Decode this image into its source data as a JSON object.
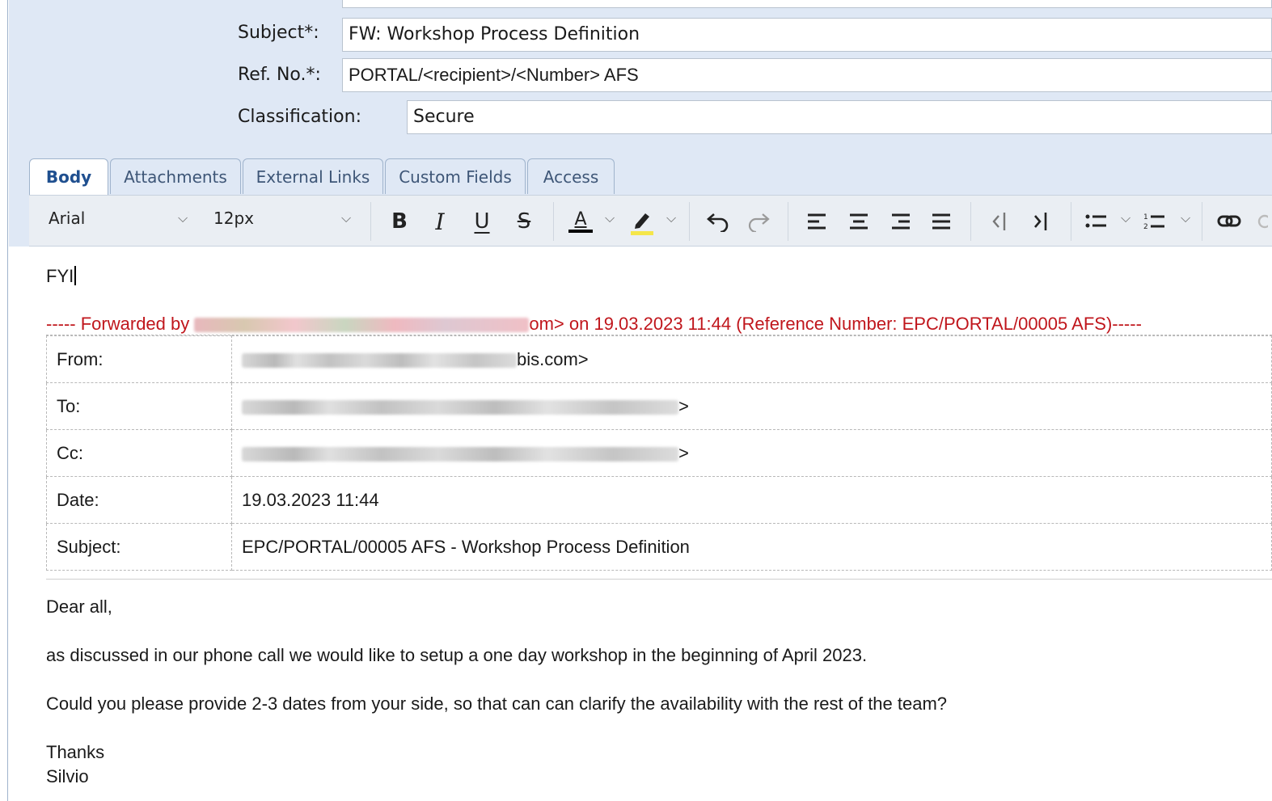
{
  "header": {
    "subject_label": "Subject*:",
    "subject_value": "FW: Workshop Process Definition",
    "ref_label": "Ref. No.*:",
    "ref_value": "PORTAL/<recipient>/<Number> AFS",
    "classification_label": "Classification:",
    "classification_value": "Secure"
  },
  "tabs": [
    {
      "label": "Body"
    },
    {
      "label": "Attachments"
    },
    {
      "label": "External Links"
    },
    {
      "label": "Custom Fields"
    },
    {
      "label": "Access"
    }
  ],
  "toolbar": {
    "font": "Arial",
    "size": "12px",
    "bold": "B",
    "italic": "I",
    "underline": "U",
    "strike": "S",
    "font_color_letter": "A",
    "chevron": "⌵",
    "icons": [
      "bold-icon",
      "italic-icon",
      "underline-icon",
      "strikethrough-icon",
      "font-color-icon",
      "highlight-icon",
      "undo-icon",
      "redo-icon",
      "align-left-icon",
      "align-center-icon",
      "align-right-icon",
      "justify-icon",
      "outdent-icon",
      "indent-icon",
      "bullet-list-icon",
      "numbered-list-icon",
      "link-icon"
    ],
    "colors": {
      "font_color_bar": "#000000",
      "highlight_bar": "#f5e64a"
    }
  },
  "body": {
    "fyi": "FYI",
    "fwd_prefix": "----- Forwarded by ",
    "fwd_suffix": "om> on 19.03.2023 11:44 (Reference Number: EPC/PORTAL/00005 AFS)-----",
    "meta": {
      "from_label": "From:",
      "from_suffix": "bis.com>",
      "to_label": "To:",
      "to_suffix": ">",
      "cc_label": "Cc:",
      "cc_suffix": ">",
      "date_label": "Date:",
      "date_value": "19.03.2023 11:44",
      "subject_label": "Subject:",
      "subject_value": "EPC/PORTAL/00005 AFS - Workshop Process Definition"
    },
    "greeting": "Dear all,",
    "para1": "as discussed in our phone call we would like to setup a one day workshop in the beginning of April 2023.",
    "para2": "Could you please provide 2-3 dates from your side, so that can can clarify the availability with the rest of the team?",
    "thanks": "Thanks",
    "signature": "Silvio"
  }
}
